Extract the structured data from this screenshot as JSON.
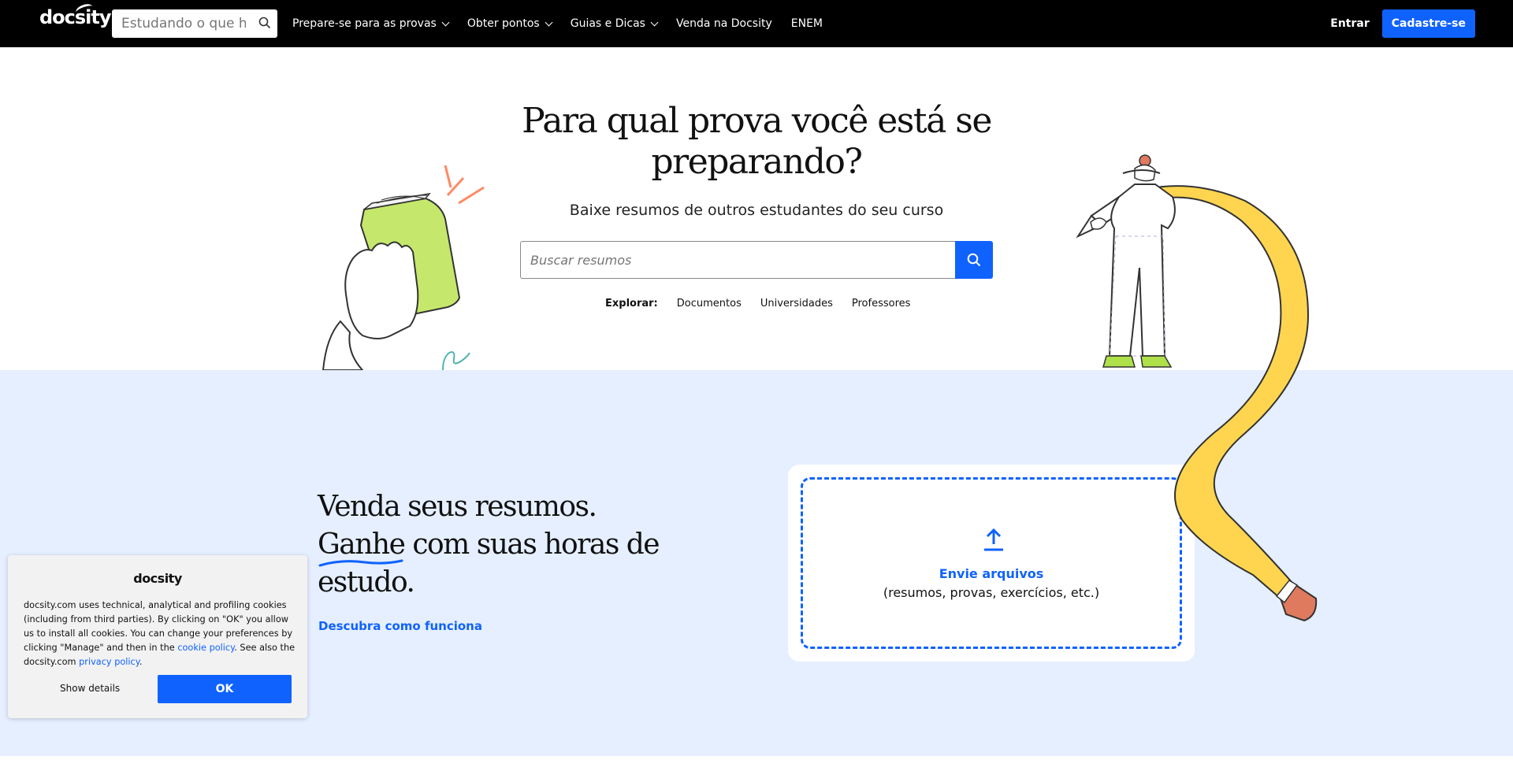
{
  "nav": {
    "logo": "docsity",
    "search_placeholder": "Estudando o que hoje?",
    "menu": [
      {
        "label": "Prepare-se para as provas",
        "dropdown": true
      },
      {
        "label": "Obter pontos",
        "dropdown": true
      },
      {
        "label": "Guias e Dicas",
        "dropdown": true
      },
      {
        "label": "Venda na Docsity",
        "dropdown": false
      },
      {
        "label": "ENEM",
        "dropdown": false
      }
    ],
    "login": "Entrar",
    "signup": "Cadastre-se"
  },
  "hero": {
    "title_line1": "Para qual prova você está se",
    "title_line2": "preparando?",
    "subtitle": "Baixe resumos de outros estudantes do seu curso",
    "search_placeholder": "Buscar resumos",
    "explore_label": "Explorar:",
    "explore_links": [
      "Documentos",
      "Universidades",
      "Professores"
    ]
  },
  "sell": {
    "title_line1": "Venda seus resumos.",
    "title_line2a": "Ganhe",
    "title_line2b": " com suas horas de",
    "title_line3": "estudo.",
    "link": "Descubra como funciona",
    "upload_label": "Envie arquivos",
    "upload_sub": "(resumos, provas, exercícios, etc.)"
  },
  "cookie": {
    "logo": "docsity",
    "text_main": "docsity.com uses technical, analytical and profiling cookies (including from third parties). By clicking on \"OK\" you allow us to install all cookies. You can change your preferences by clicking \"Manage\" and then in the ",
    "link_policy": "cookie policy",
    "text_mid": ". See also the docsity.com ",
    "link_privacy": "privacy policy",
    "text_end": ".",
    "details": "Show details",
    "ok": "OK"
  },
  "colors": {
    "brand_blue": "#0f62fe",
    "nav_bg": "#000000",
    "section_bg": "#e5efff"
  }
}
